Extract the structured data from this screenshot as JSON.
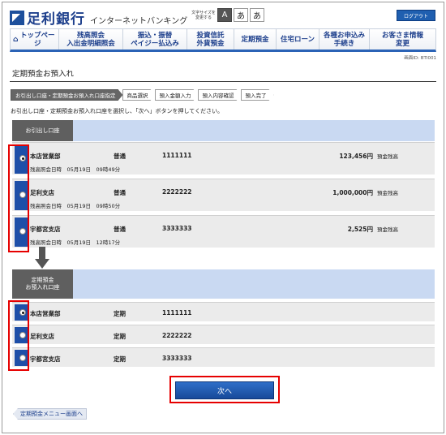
{
  "header": {
    "bank_name": "足利銀行",
    "service_name": "インターネットバンキング",
    "font_size_label": "文字サイズを変更する",
    "font_sizes": [
      "A",
      "あ",
      "あ"
    ],
    "logout_label": "ログアウト"
  },
  "nav": {
    "items": [
      {
        "label": "トップページ",
        "icon": "home-icon"
      },
      {
        "label": "残高照会\n入出金明細照会"
      },
      {
        "label": "振込・振替\nペイジー払込み"
      },
      {
        "label": "投資信託\n外貨預金"
      },
      {
        "label": "定期預金"
      },
      {
        "label": "住宅ローン"
      },
      {
        "label": "各種お申込み\n手続き"
      },
      {
        "label": "お客さま情報\n変更"
      }
    ]
  },
  "screen_id": "画面ID: BTI001",
  "page_title": "定期預金お預入れ",
  "steps": [
    "お引出し口座・定期預金お預入れ口座指定",
    "商品選択",
    "預入金額入力",
    "預入内容確認",
    "預入完了"
  ],
  "instruction": "お引出し口座・定期預金お預入れ口座を選択し、「次へ」ボタンを押してください。",
  "withdraw_section": {
    "label": "お引出し口座",
    "accounts": [
      {
        "branch": "本店営業部",
        "type": "普通",
        "number": "1111111",
        "balance": "123,456円",
        "balance_label": "預金残高",
        "inquiry": "残高照会日時　05月19日　09時49分",
        "selected": true
      },
      {
        "branch": "足利支店",
        "type": "普通",
        "number": "2222222",
        "balance": "1,000,000円",
        "balance_label": "預金残高",
        "inquiry": "残高照会日時　05月19日　09時50分",
        "selected": false
      },
      {
        "branch": "宇都宮支店",
        "type": "普通",
        "number": "3333333",
        "balance": "2,525円",
        "balance_label": "預金残高",
        "inquiry": "残高照会日時　05月19日　12時17分",
        "selected": false
      }
    ]
  },
  "deposit_section": {
    "label": "定期預金\nお預入れ口座",
    "accounts": [
      {
        "branch": "本店営業部",
        "type": "定期",
        "number": "1111111",
        "selected": true
      },
      {
        "branch": "足利支店",
        "type": "定期",
        "number": "2222222",
        "selected": false
      },
      {
        "branch": "宇都宮支店",
        "type": "定期",
        "number": "3333333",
        "selected": false
      }
    ]
  },
  "next_button": "次へ",
  "back_link": "定期預金メニュー画面へ"
}
